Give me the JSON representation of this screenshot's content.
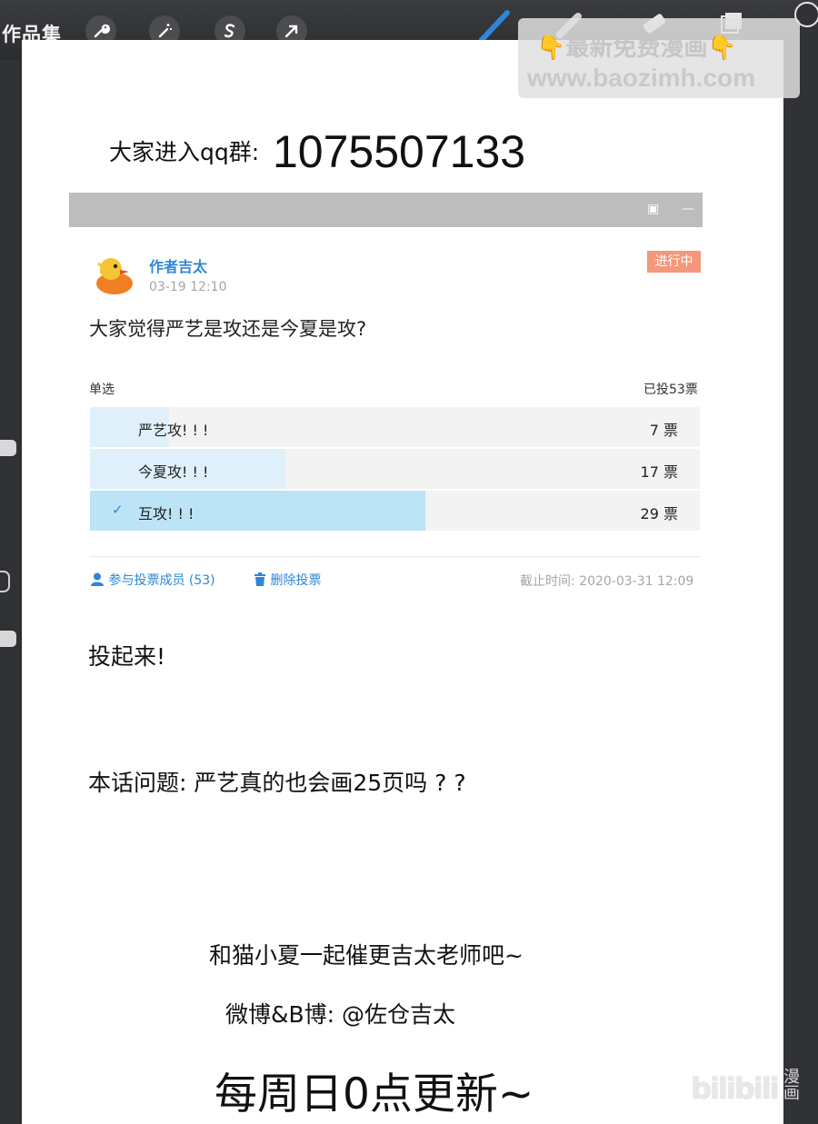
{
  "toolbar": {
    "gallery_label": "作品集",
    "tools": [
      "wrench-icon",
      "magic-wand-icon",
      "selection-s-icon",
      "transform-arrow-icon"
    ],
    "right_tools": [
      "brush-icon",
      "smudge-icon",
      "eraser-icon",
      "layers-icon",
      "color-icon"
    ]
  },
  "watermark": {
    "line1": "最新免费漫画",
    "line2": "www.baozimh.com"
  },
  "qq": {
    "prefix": "大家进入qq群:",
    "number": "1075507133"
  },
  "poll": {
    "author": "作者吉太",
    "time": "03-19 12:10",
    "status": "进行中",
    "question": "大家觉得严艺是攻还是今夏是攻?",
    "mode": "单选",
    "total": "已投53票",
    "options": [
      {
        "label": "严艺攻! ! !",
        "votes": "7 票",
        "fraction": 0.13,
        "selected": false
      },
      {
        "label": "今夏攻! ! !",
        "votes": "17 票",
        "fraction": 0.32,
        "selected": false
      },
      {
        "label": "互攻! ! !",
        "votes": "29 票",
        "fraction": 0.55,
        "selected": true
      }
    ],
    "participants": "参与投票成员 (53)",
    "delete": "删除投票",
    "deadline": "截止时间: 2020-03-31 12:09",
    "check_mark": "✓"
  },
  "body": {
    "line1": "投起来!",
    "line2": "本话问题: 严艺真的也会画25页吗 ? ?",
    "line3": "和猫小夏一起催更吉太老师吧~",
    "line4": "微博&B博: @佐仓吉太",
    "line5": "每周日0点更新~"
  },
  "logo": {
    "main": "bilibili",
    "sub": "漫画"
  },
  "colors": {
    "accent_blue": "#2f86d6",
    "status_orange": "#f5977a",
    "fill_light": "#dff0fb",
    "fill_selected": "#bde3f7"
  }
}
